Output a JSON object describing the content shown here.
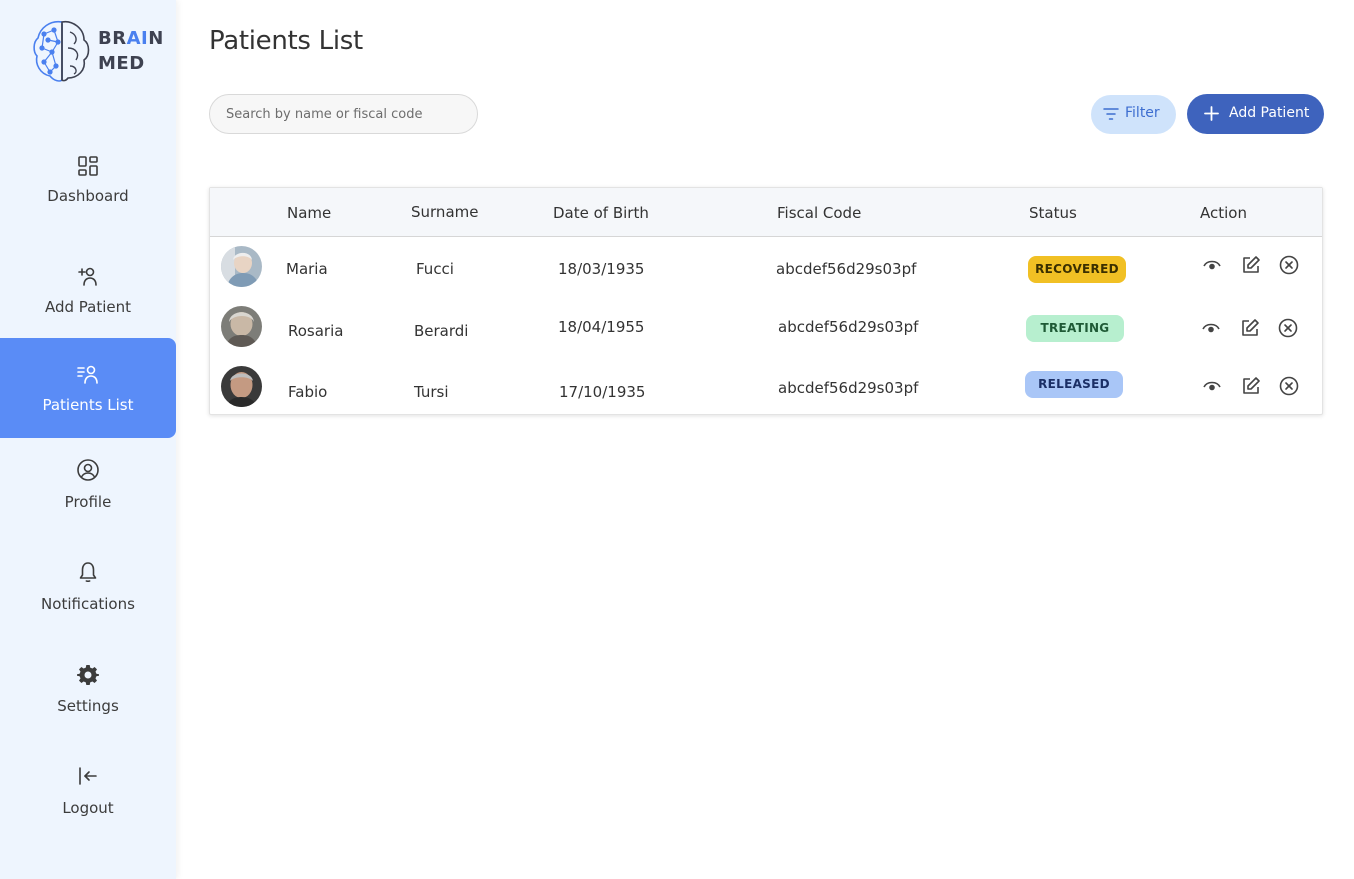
{
  "brand": {
    "line1_a": "BR",
    "line1_b": "AI",
    "line1_c": "N",
    "line2": "MED"
  },
  "sidebar": {
    "items": [
      {
        "label": "Dashboard",
        "icon": "dashboard-icon"
      },
      {
        "label": "Add Patient",
        "icon": "add-user-icon"
      },
      {
        "label": "Patients List",
        "icon": "patients-list-icon",
        "active": true
      },
      {
        "label": "Profile",
        "icon": "profile-icon"
      },
      {
        "label": "Notifications",
        "icon": "bell-icon"
      },
      {
        "label": "Settings",
        "icon": "gear-icon"
      },
      {
        "label": "Logout",
        "icon": "logout-icon"
      }
    ]
  },
  "header": {
    "title": "Patients List"
  },
  "search": {
    "placeholder": "Search by name or fiscal code"
  },
  "toolbar": {
    "filter_label": "Filter",
    "add_label": "Add Patient"
  },
  "table": {
    "columns": [
      "Name",
      "Surname",
      "Date of Birth",
      "Fiscal Code",
      "Status",
      "Action"
    ],
    "rows": [
      {
        "name": "Maria",
        "surname": "Fucci",
        "dob": "18/03/1935",
        "fiscal": "abcdef56d29s03pf",
        "status": "RECOVERED"
      },
      {
        "name": "Rosaria",
        "surname": "Berardi",
        "dob": "18/04/1955",
        "fiscal": "abcdef56d29s03pf",
        "status": "TREATING"
      },
      {
        "name": "Fabio",
        "surname": "Tursi",
        "dob": "17/10/1935",
        "fiscal": "abcdef56d29s03pf",
        "status": "RELEASED"
      }
    ]
  },
  "colors": {
    "accent": "#5a8cf6",
    "primary_button": "#3e63bd",
    "recovered": "#f1c024",
    "treating": "#b7efcf",
    "released": "#a9c6f7"
  }
}
